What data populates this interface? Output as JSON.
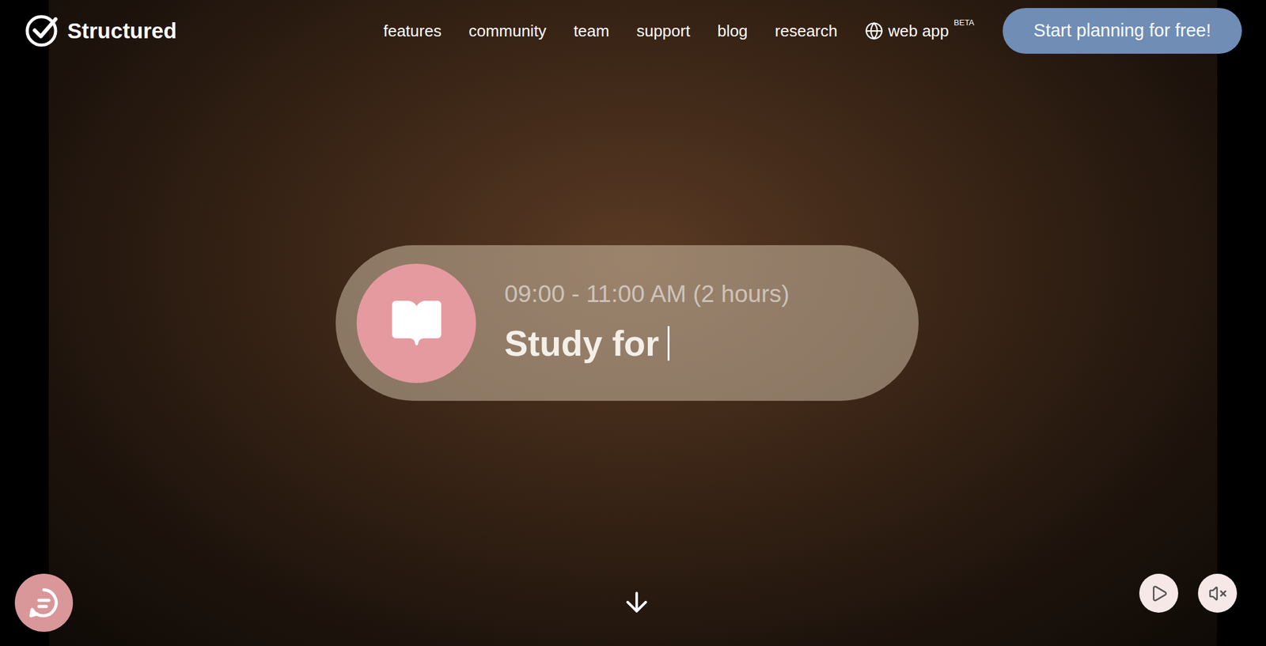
{
  "brand": {
    "name": "Structured"
  },
  "nav": {
    "items": [
      "features",
      "community",
      "team",
      "support",
      "blog",
      "research"
    ],
    "web_app": {
      "label": "web app",
      "badge": "BETA"
    },
    "cta": "Start planning for free!"
  },
  "hero": {
    "task_card": {
      "time": "09:00 - 11:00 AM (2 hours)",
      "title": "Study for",
      "typing": true
    }
  },
  "video_controls": {
    "playing": false,
    "muted": true
  }
}
